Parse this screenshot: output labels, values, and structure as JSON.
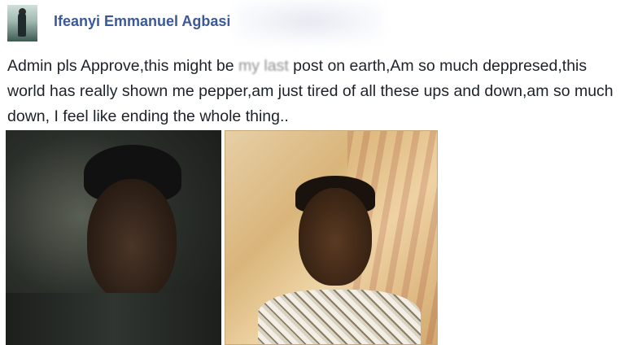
{
  "post": {
    "author_name": "Ifeanyi Emmanuel Agbasi",
    "message_before_blur": "Admin pls Approve,this might be ",
    "message_blurred": "my last",
    "message_after_blur": " post on earth,Am so much deppresed,this world has really shown me pepper,am just tired of all these ups and down,am so much down, I feel like ending the whole thing..",
    "photos": [
      {
        "label": ""
      },
      {
        "label": ""
      }
    ]
  },
  "colors": {
    "author_link": "#3b5998",
    "text": "#1d2129",
    "background": "#ffffff"
  },
  "icons": {
    "avatar": "profile-avatar"
  }
}
